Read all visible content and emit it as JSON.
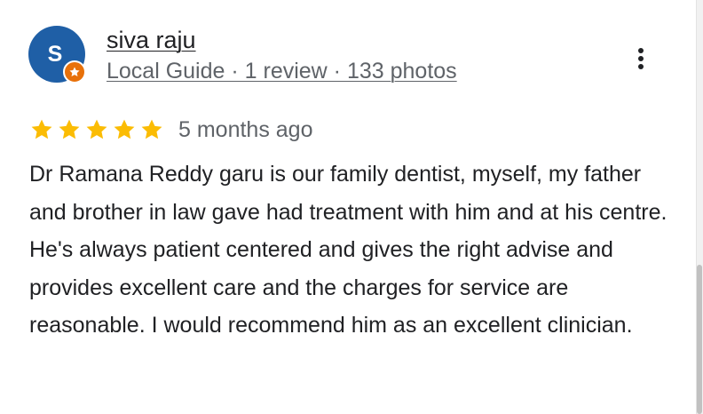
{
  "review": {
    "author": {
      "initial": "S",
      "name": "siva raju",
      "meta": "Local Guide · 1 review · 133 photos",
      "avatar_color": "#1f5fa6",
      "badge_color": "#e8710a"
    },
    "rating": 5,
    "max_rating": 5,
    "star_color": "#fbbc04",
    "date": "5 months ago",
    "text": "Dr Ramana Reddy garu is our family dentist, myself, my father and brother in law gave had treatment with him and at his centre. He's always patient centered and gives the right advise and provides excellent care and the charges for service are reasonable. I would recommend him as an excellent clinician.",
    "menu_icon": "more-vert-icon"
  }
}
